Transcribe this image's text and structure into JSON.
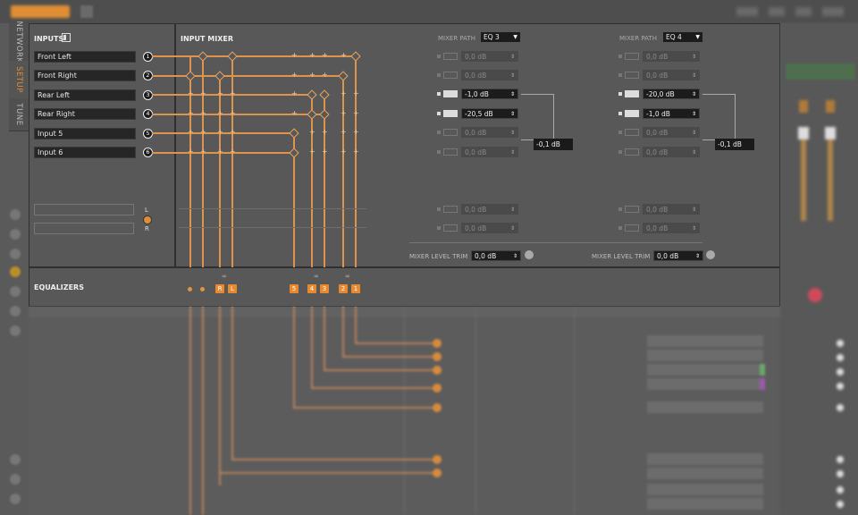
{
  "colors": {
    "accent": "#e08e35",
    "line": "#e0934a",
    "panel": "#585858",
    "box": "#1c1c1c"
  },
  "tabs": [
    {
      "label": "NETWORK"
    },
    {
      "label": "SETUP"
    },
    {
      "label": "TUNE"
    }
  ],
  "inputs": {
    "title": "INPUTS",
    "channels": [
      {
        "name": "Front Left",
        "num": "1"
      },
      {
        "name": "Front Right",
        "num": "2"
      },
      {
        "name": "Rear Left",
        "num": "3"
      },
      {
        "name": "Rear Right",
        "num": "4"
      },
      {
        "name": "Input 5",
        "num": "5"
      },
      {
        "name": "Input 6",
        "num": "6"
      }
    ],
    "left_label": "L",
    "right_label": "R"
  },
  "mixer": {
    "title": "INPUT MIXER",
    "path_label": "MIXER PATH",
    "trim_label": "MIXER LEVEL TRIM",
    "paths": [
      {
        "eq": "EQ 3",
        "trim": "0,0 dB",
        "sum": "-0,1 dB",
        "rows": [
          "0,0 dB",
          "0,0 dB",
          "-1,0 dB",
          "-20,5 dB",
          "0,0 dB",
          "0,0 dB",
          "0,0 dB",
          "0,0 dB"
        ]
      },
      {
        "eq": "EQ 4",
        "trim": "0,0 dB",
        "sum": "-0,1 dB",
        "rows": [
          "0,0 dB",
          "0,0 dB",
          "-20,0 dB",
          "-1,0 dB",
          "0,0 dB",
          "0,0 dB",
          "0,0 dB",
          "0,0 dB"
        ]
      }
    ]
  },
  "equalizers": {
    "title": "EQUALIZERS",
    "badges": [
      "R",
      "L",
      "5",
      "4",
      "3",
      "2",
      "1"
    ]
  }
}
